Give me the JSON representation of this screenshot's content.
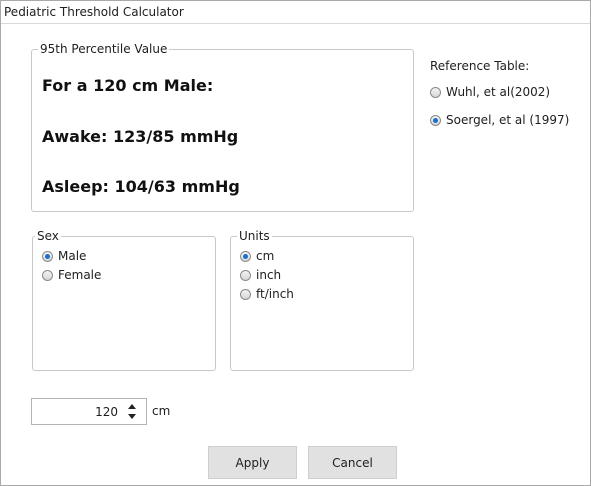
{
  "window": {
    "title": "Pediatric Threshold Calculator"
  },
  "percentile_box": {
    "legend": "95th Percentile Value",
    "line1": "For a 120 cm Male:",
    "line2": "Awake: 123/85 mmHg",
    "line3": "Asleep: 104/63 mmHg"
  },
  "reference": {
    "label": "Reference Table:",
    "options": [
      {
        "label": "Wuhl, et al(2002)",
        "selected": false
      },
      {
        "label": "Soergel, et al (1997)",
        "selected": true
      }
    ]
  },
  "sex": {
    "legend": "Sex",
    "options": [
      {
        "label": "Male",
        "selected": true
      },
      {
        "label": "Female",
        "selected": false
      }
    ]
  },
  "units": {
    "legend": "Units",
    "options": [
      {
        "label": "cm",
        "selected": true
      },
      {
        "label": "inch",
        "selected": false
      },
      {
        "label": "ft/inch",
        "selected": false
      }
    ]
  },
  "height_input": {
    "value": "120",
    "unit": "cm"
  },
  "buttons": {
    "apply": "Apply",
    "cancel": "Cancel"
  },
  "colors": {
    "radio_selected": "#1b6fc8",
    "button_bg": "#e1e1e1",
    "border": "#c9c9c9"
  }
}
